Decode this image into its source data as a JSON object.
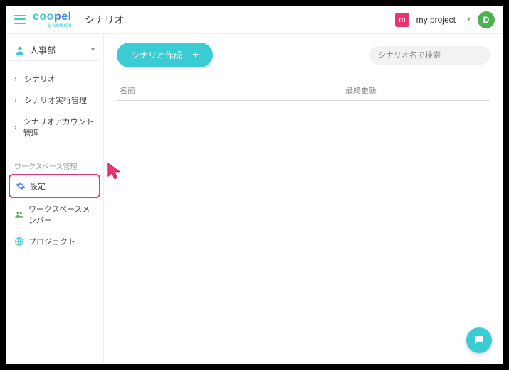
{
  "header": {
    "page_title": "シナリオ",
    "project_badge": "m",
    "project_name": "my project",
    "avatar_initial": "D"
  },
  "sidebar": {
    "workspace_name": "人事部",
    "nav": [
      {
        "label": "シナリオ"
      },
      {
        "label": "シナリオ実行管理"
      },
      {
        "label": "シナリオアカウント管理"
      }
    ],
    "section_label": "ワークスペース管理",
    "mgmt": [
      {
        "label": "設定"
      },
      {
        "label": "ワークスペースメンバー"
      },
      {
        "label": "プロジェクト"
      }
    ]
  },
  "main": {
    "create_button": "シナリオ作成",
    "search_placeholder": "シナリオ名で検索",
    "columns": {
      "name": "名前",
      "updated": "最終更新"
    }
  }
}
